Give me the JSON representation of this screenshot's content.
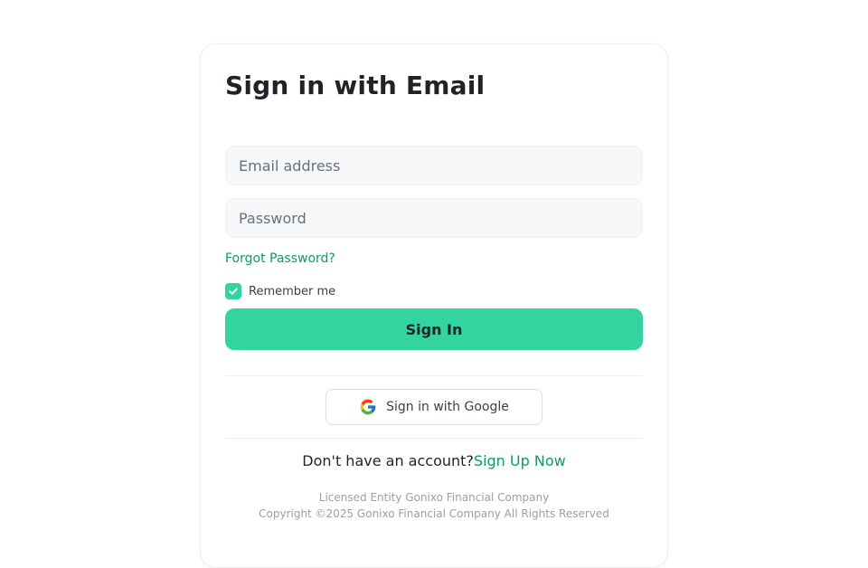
{
  "form": {
    "title": "Sign in with Email",
    "email_placeholder": "Email address",
    "password_placeholder": "Password",
    "forgot_label": "Forgot Password?",
    "remember_label": "Remember me",
    "remember_checked": true,
    "submit_label": "Sign In"
  },
  "social": {
    "google_label": "Sign in with Google",
    "google_icon": "google-icon"
  },
  "signup": {
    "prompt": "Don't have an account?",
    "link_label": "Sign Up Now"
  },
  "footer": {
    "line1": "Licensed Entity Gonixo Financial Company",
    "line2": "Copyright ©2025 Gonixo Financial Company All Rights Reserved"
  },
  "colors": {
    "accent": "#33d49f",
    "link": "#0f9a6a",
    "input_bg": "#f6f7f9",
    "text": "#1f2328"
  }
}
